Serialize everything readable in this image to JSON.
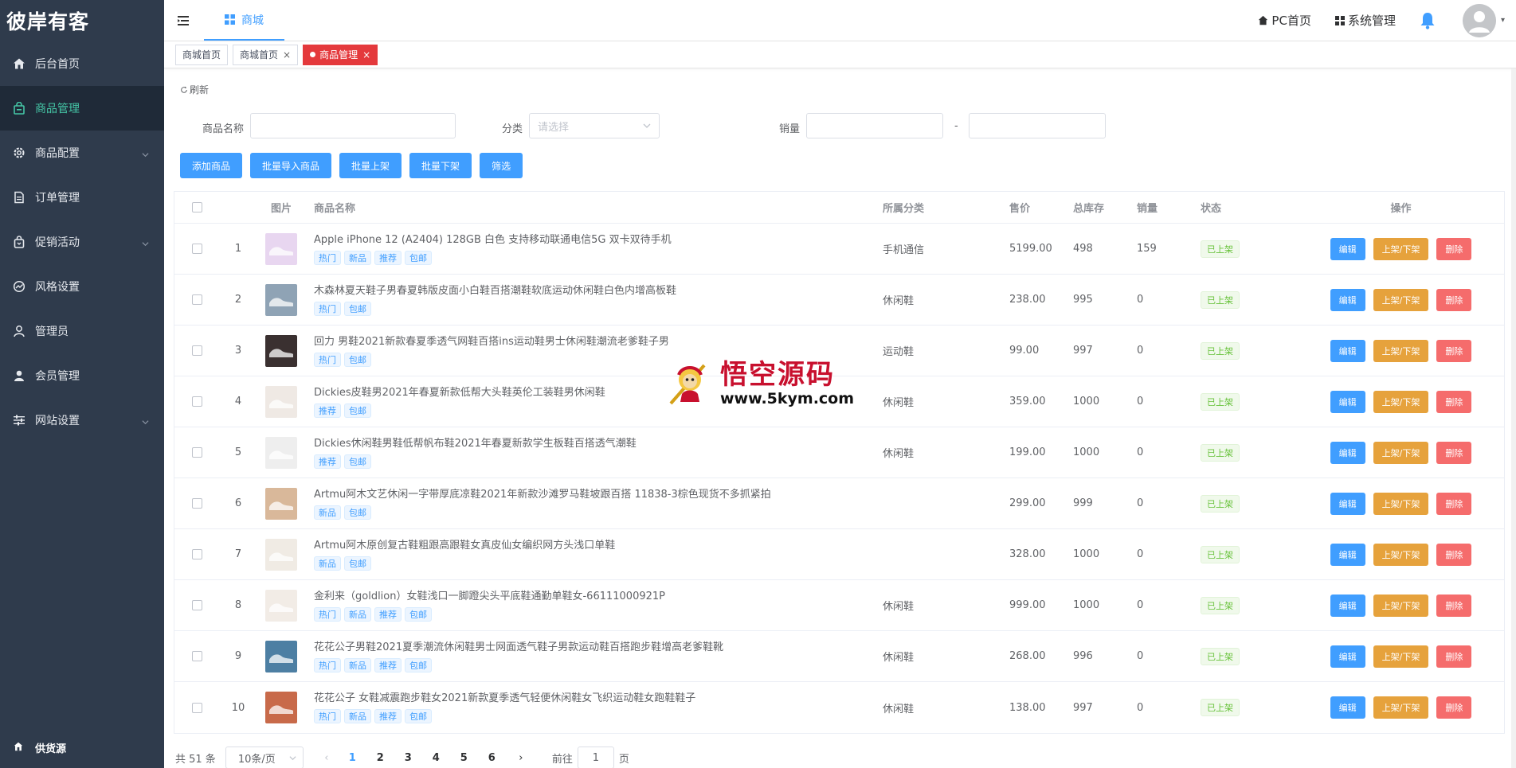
{
  "brand": {
    "logo_text": "彼岸有客"
  },
  "sidebar": {
    "items": [
      {
        "label": "后台首页",
        "icon": "home-icon",
        "active": false,
        "expandable": false
      },
      {
        "label": "商品管理",
        "icon": "bag-icon",
        "active": true,
        "expandable": false
      },
      {
        "label": "商品配置",
        "icon": "gear-icon",
        "active": false,
        "expandable": true
      },
      {
        "label": "订单管理",
        "icon": "document-icon",
        "active": false,
        "expandable": false
      },
      {
        "label": "促销活动",
        "icon": "shopping-bag-icon",
        "active": false,
        "expandable": true
      },
      {
        "label": "风格设置",
        "icon": "palette-icon",
        "active": false,
        "expandable": false
      },
      {
        "label": "管理员",
        "icon": "user-icon",
        "active": false,
        "expandable": false
      },
      {
        "label": "会员管理",
        "icon": "member-icon",
        "active": false,
        "expandable": false
      },
      {
        "label": "网站设置",
        "icon": "sliders-icon",
        "active": false,
        "expandable": true
      }
    ],
    "bottom_label": "供货源"
  },
  "header": {
    "tab_label": "商城",
    "pc_home": "PC首页",
    "system_manage": "系统管理"
  },
  "tags": [
    {
      "label": "商城首页",
      "closable": false,
      "active": false
    },
    {
      "label": "商城首页",
      "closable": true,
      "active": false
    },
    {
      "label": "商品管理",
      "closable": true,
      "active": true
    }
  ],
  "toolbar": {
    "refresh_label": "刷新"
  },
  "filter": {
    "name_label": "商品名称",
    "name_value": "",
    "category_label": "分类",
    "category_placeholder": "请选择",
    "sales_label": "销量",
    "sales_min": "",
    "sales_sep": "-",
    "sales_max": ""
  },
  "actions": [
    "添加商品",
    "批量导入商品",
    "批量上架",
    "批量下架",
    "筛选"
  ],
  "table": {
    "headers": {
      "image": "图片",
      "name": "商品名称",
      "category": "所属分类",
      "price": "售价",
      "stock": "总库存",
      "sales": "销量",
      "status": "状态",
      "ops": "操作"
    },
    "op_labels": {
      "edit": "编辑",
      "shelf": "上架/下架",
      "delete": "删除"
    },
    "rows": [
      {
        "idx": "1",
        "name": "Apple iPhone 12 (A2404) 128GB 白色 支持移动联通电信5G 双卡双待手机",
        "tags": [
          "热门",
          "新品",
          "推荐",
          "包邮"
        ],
        "category": "手机通信",
        "price": "5199.00",
        "stock": "498",
        "sales": "159",
        "status": "已上架",
        "thumb_color": "#e8d6f0"
      },
      {
        "idx": "2",
        "name": "木森林夏天鞋子男春夏韩版皮面小白鞋百搭潮鞋软底运动休闲鞋白色内增高板鞋",
        "tags": [
          "热门",
          "包邮"
        ],
        "category": "休闲鞋",
        "price": "238.00",
        "stock": "995",
        "sales": "0",
        "status": "已上架",
        "thumb_color": "#8fa3b5"
      },
      {
        "idx": "3",
        "name": "回力 男鞋2021新款春夏季透气网鞋百搭ins运动鞋男士休闲鞋潮流老爹鞋子男",
        "tags": [
          "热门",
          "包邮"
        ],
        "category": "运动鞋",
        "price": "99.00",
        "stock": "997",
        "sales": "0",
        "status": "已上架",
        "thumb_color": "#3a3030"
      },
      {
        "idx": "4",
        "name": "Dickies皮鞋男2021年春夏新款低帮大头鞋英伦工装鞋男休闲鞋",
        "tags": [
          "推荐",
          "包邮"
        ],
        "category": "休闲鞋",
        "price": "359.00",
        "stock": "1000",
        "sales": "0",
        "status": "已上架",
        "thumb_color": "#efe9e4"
      },
      {
        "idx": "5",
        "name": "Dickies休闲鞋男鞋低帮帆布鞋2021年春夏新款学生板鞋百搭透气潮鞋",
        "tags": [
          "推荐",
          "包邮"
        ],
        "category": "休闲鞋",
        "price": "199.00",
        "stock": "1000",
        "sales": "0",
        "status": "已上架",
        "thumb_color": "#eeeeee"
      },
      {
        "idx": "6",
        "name": "Artmu阿木文艺休闲一字带厚底凉鞋2021年新款沙滩罗马鞋坡跟百搭 11838-3棕色现货不多抓紧拍",
        "tags": [
          "新品",
          "包邮"
        ],
        "category": "",
        "price": "299.00",
        "stock": "999",
        "sales": "0",
        "status": "已上架",
        "thumb_color": "#d9b89a"
      },
      {
        "idx": "7",
        "name": "Artmu阿木原创复古鞋粗跟高跟鞋女真皮仙女编织网方头浅口单鞋",
        "tags": [
          "新品",
          "包邮"
        ],
        "category": "",
        "price": "328.00",
        "stock": "1000",
        "sales": "0",
        "status": "已上架",
        "thumb_color": "#f0ebe4"
      },
      {
        "idx": "8",
        "name": "金利来（goldlion）女鞋浅口一脚蹬尖头平底鞋通勤单鞋女-66111000921P",
        "tags": [
          "热门",
          "新品",
          "推荐",
          "包邮"
        ],
        "category": "休闲鞋",
        "price": "999.00",
        "stock": "1000",
        "sales": "0",
        "status": "已上架",
        "thumb_color": "#f2ece6"
      },
      {
        "idx": "9",
        "name": "花花公子男鞋2021夏季潮流休闲鞋男士网面透气鞋子男款运动鞋百搭跑步鞋增高老爹鞋靴",
        "tags": [
          "热门",
          "新品",
          "推荐",
          "包邮"
        ],
        "category": "休闲鞋",
        "price": "268.00",
        "stock": "996",
        "sales": "0",
        "status": "已上架",
        "thumb_color": "#4d7fa3"
      },
      {
        "idx": "10",
        "name": "花花公子 女鞋减震跑步鞋女2021新款夏季透气轻便休闲鞋女飞织运动鞋女跑鞋鞋子",
        "tags": [
          "热门",
          "新品",
          "推荐",
          "包邮"
        ],
        "category": "休闲鞋",
        "price": "138.00",
        "stock": "997",
        "sales": "0",
        "status": "已上架",
        "thumb_color": "#c86a4a"
      }
    ]
  },
  "pagination": {
    "total_text": "共 51 条",
    "page_size": "10条/页",
    "pages": [
      "1",
      "2",
      "3",
      "4",
      "5",
      "6"
    ],
    "current": "1",
    "goto_label": "前往",
    "goto_value": "1",
    "goto_suffix": "页"
  },
  "watermark": {
    "cn": "悟空源码",
    "url": "www.5kym.com"
  },
  "colors": {
    "primary": "#409eff",
    "warning": "#e6a23c",
    "danger": "#f56c6c",
    "success": "#67c23a",
    "sidebar_bg": "#2f3b4c",
    "sidebar_active_text": "#45c6a6",
    "active_tag": "#e4393c"
  }
}
